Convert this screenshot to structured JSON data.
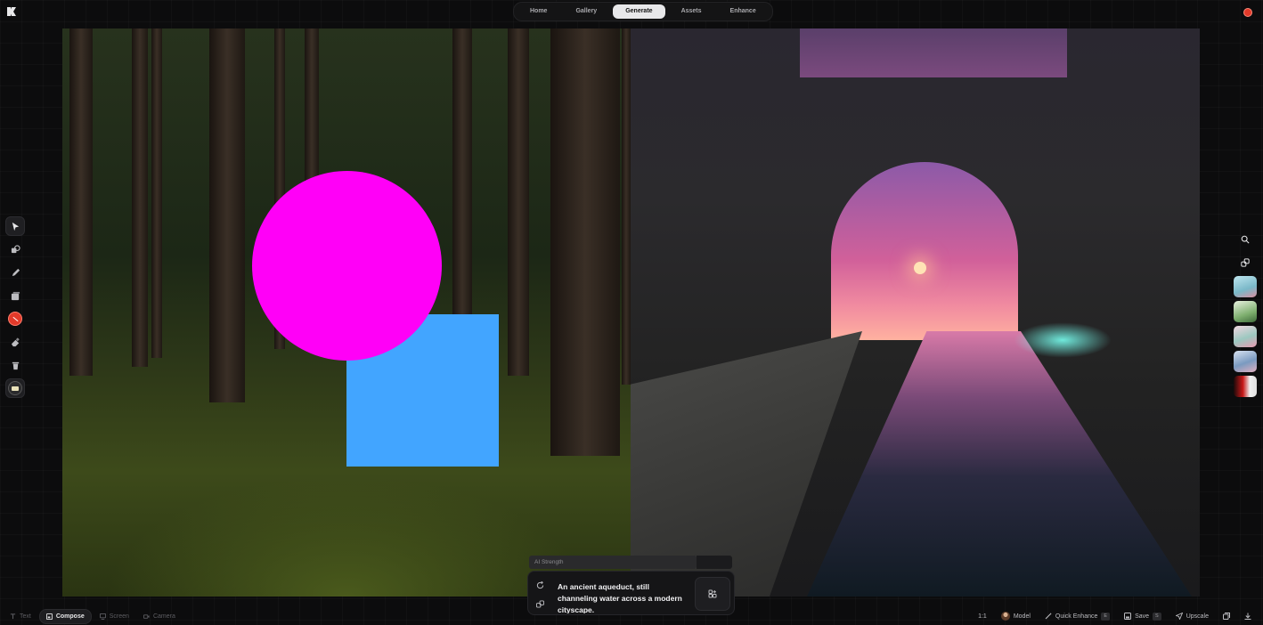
{
  "nav": {
    "items": [
      {
        "label": "Home",
        "active": false
      },
      {
        "label": "Gallery",
        "active": false
      },
      {
        "label": "Generate",
        "active": true
      },
      {
        "label": "Assets",
        "active": false
      },
      {
        "label": "Enhance",
        "active": false
      }
    ]
  },
  "colors": {
    "accent_red": "#e23a2a",
    "shape_circle": "#ff00f7",
    "shape_square": "#42a5ff",
    "background": "#0c0c0d"
  },
  "left_tools": [
    {
      "name": "select-tool",
      "icon": "pointer-icon"
    },
    {
      "name": "shapes-tool",
      "icon": "shapes-icon"
    },
    {
      "name": "pen-tool",
      "icon": "pen-icon"
    },
    {
      "name": "image-tool",
      "icon": "image-stack-icon"
    },
    {
      "name": "color-tool",
      "icon": "color-swatch-icon"
    },
    {
      "name": "eraser-tool",
      "icon": "eraser-icon"
    },
    {
      "name": "delete-tool",
      "icon": "trash-icon"
    },
    {
      "name": "background-tool",
      "icon": "background-swatch-icon"
    }
  ],
  "right_tools": [
    {
      "name": "search-button",
      "icon": "search-icon"
    },
    {
      "name": "link-button",
      "icon": "link-icon"
    }
  ],
  "modes": {
    "text": "Text",
    "compose": "Compose",
    "screen": "Screen",
    "camera": "Camera"
  },
  "prompt": {
    "ai_strength_label": "AI Strength",
    "text": "An ancient aqueduct, still channeling water across a modern cityscape."
  },
  "bottom_right": {
    "ratio": "1:1",
    "model_label": "Model",
    "quick_enhance_label": "Quick Enhance",
    "quick_enhance_key": "E",
    "save_label": "Save",
    "save_key": "S",
    "upscale_label": "Upscale"
  }
}
